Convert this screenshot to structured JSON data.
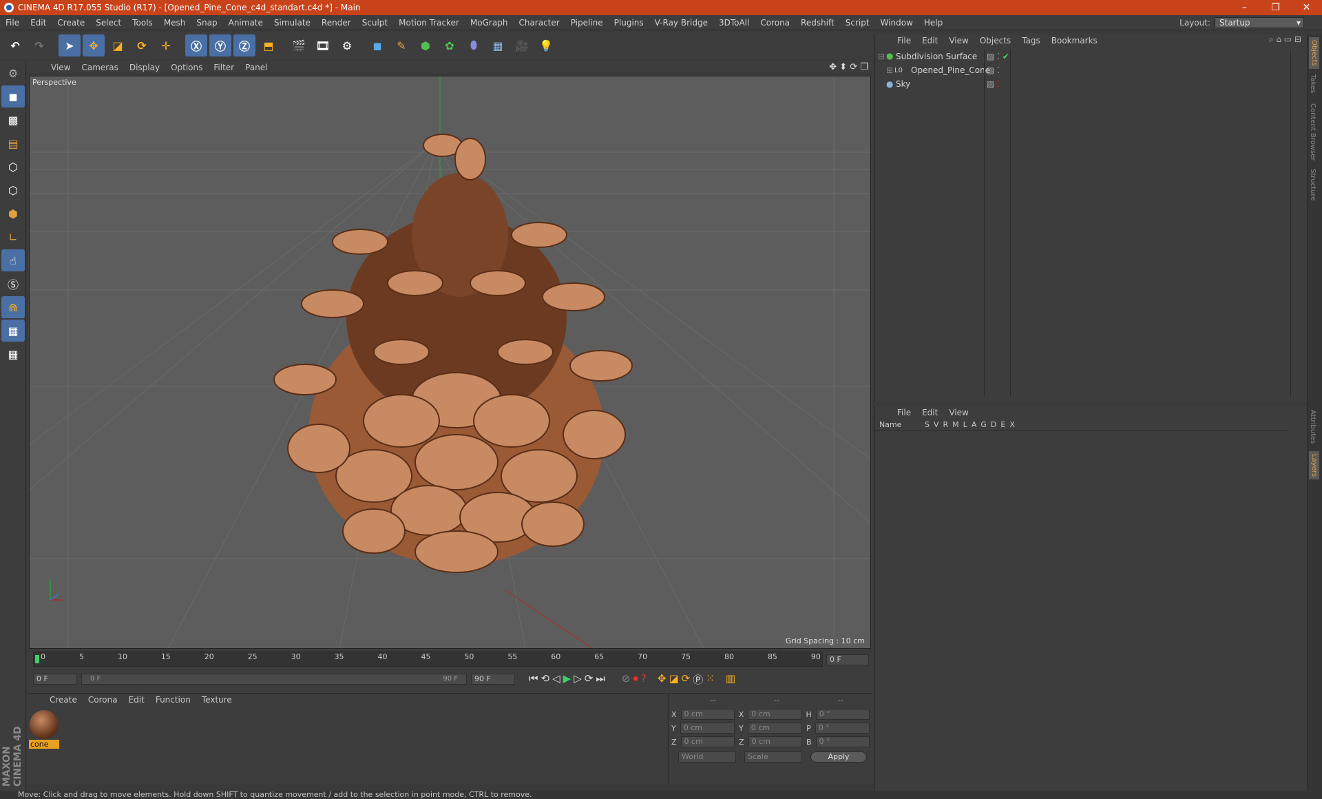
{
  "titlebar": {
    "title": "CINEMA 4D R17.055 Studio (R17) - [Opened_Pine_Cone_c4d_standart.c4d *] - Main",
    "minimize": "–",
    "maximize": "❐",
    "close": "✕"
  },
  "menubar": {
    "items": [
      "File",
      "Edit",
      "Create",
      "Select",
      "Tools",
      "Mesh",
      "Snap",
      "Animate",
      "Simulate",
      "Render",
      "Sculpt",
      "Motion Tracker",
      "MoGraph",
      "Character",
      "Pipeline",
      "Plugins",
      "V-Ray Bridge",
      "3DToAll",
      "Corona",
      "Redshift",
      "Script",
      "Window",
      "Help"
    ]
  },
  "layout": {
    "label": "Layout:",
    "value": "Startup"
  },
  "viewport": {
    "menu": [
      "View",
      "Cameras",
      "Display",
      "Options",
      "Filter",
      "Panel"
    ],
    "label": "Perspective",
    "grid_spacing": "Grid Spacing : 10 cm"
  },
  "timeline": {
    "ticks": [
      "0",
      "5",
      "10",
      "15",
      "20",
      "25",
      "30",
      "35",
      "40",
      "45",
      "50",
      "55",
      "60",
      "65",
      "70",
      "75",
      "80",
      "85",
      "90"
    ],
    "current_frame": "0 F",
    "start_field": "0 F",
    "range_start": "0 F",
    "range_end": "90 F",
    "end_field": "90 F"
  },
  "materials": {
    "menu": [
      "Create",
      "Corona",
      "Edit",
      "Function",
      "Texture"
    ],
    "items": [
      {
        "name": "cone"
      }
    ]
  },
  "coords": {
    "headers": [
      "--",
      "--",
      "--"
    ],
    "rows": [
      {
        "a": "X",
        "av": "0 cm",
        "b": "X",
        "bv": "0 cm",
        "c": "H",
        "cv": "0 °"
      },
      {
        "a": "Y",
        "av": "0 cm",
        "b": "Y",
        "bv": "0 cm",
        "c": "P",
        "cv": "0 °"
      },
      {
        "a": "Z",
        "av": "0 cm",
        "b": "Z",
        "bv": "0 cm",
        "c": "B",
        "cv": "0 °"
      }
    ],
    "world": "World",
    "scale": "Scale",
    "apply": "Apply"
  },
  "object_manager": {
    "menu": [
      "File",
      "Edit",
      "View",
      "Objects",
      "Tags",
      "Bookmarks"
    ],
    "objects": [
      "Subdivision Surface",
      "Opened_Pine_Cone",
      "Sky"
    ],
    "layer_icon": "L0"
  },
  "layer_manager": {
    "menu": [
      "File",
      "Edit",
      "View"
    ],
    "columns": [
      "Name",
      "S",
      "V",
      "R",
      "M",
      "L",
      "A",
      "G",
      "D",
      "E",
      "X"
    ]
  },
  "side_tabs": {
    "top": [
      "Objects",
      "Takes",
      "Content Browser",
      "Structure"
    ],
    "bottom": [
      "Attributes",
      "Layers"
    ]
  },
  "brand": "MAXON CINEMA 4D",
  "status": "Move: Click and drag to move elements. Hold down SHIFT to quantize movement / add to the selection in point mode, CTRL to remove."
}
